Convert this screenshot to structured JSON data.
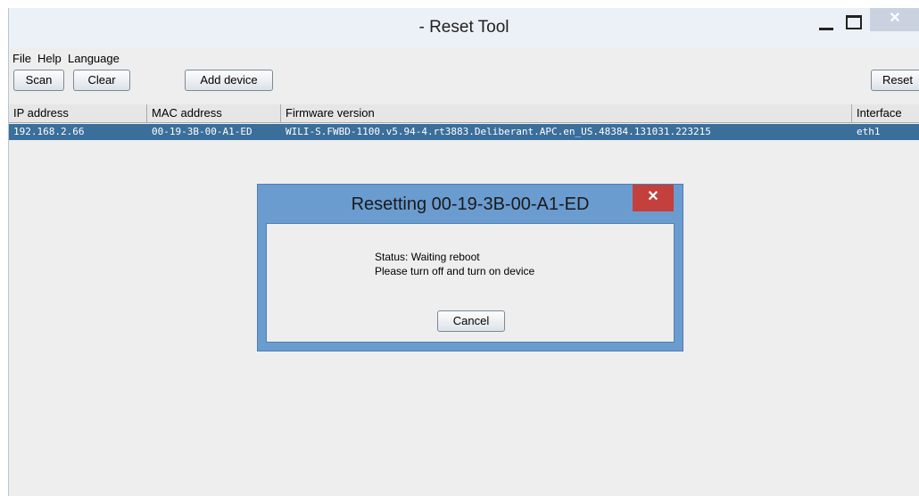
{
  "window": {
    "title": "- Reset Tool",
    "minimize_icon": "minimize-icon",
    "maximize_icon": "maximize-icon",
    "close_glyph": "✕"
  },
  "menubar": {
    "file": "File",
    "help": "Help",
    "language": "Language"
  },
  "toolbar": {
    "scan": "Scan",
    "clear": "Clear",
    "add_device": "Add device",
    "reset": "Reset"
  },
  "table": {
    "headers": [
      "IP address",
      "MAC address",
      "Firmware version",
      "Interface"
    ],
    "rows": [
      {
        "ip": "192.168.2.66",
        "mac": "00-19-3B-00-A1-ED",
        "firmware": "WILI-S.FWBD-1100.v5.94-4.rt3883.Deliberant.APC.en_US.48384.131031.223215",
        "interface": "eth1",
        "selected": true
      }
    ]
  },
  "dialog": {
    "title": "Resetting 00-19-3B-00-A1-ED",
    "close_glyph": "✕",
    "status": "Status: Waiting reboot",
    "message": "Please turn off and turn on device",
    "cancel": "Cancel"
  },
  "colors": {
    "selection": "#3a6e9b",
    "dialog_frame": "#6b9cd0",
    "dialog_close": "#c4403d"
  }
}
